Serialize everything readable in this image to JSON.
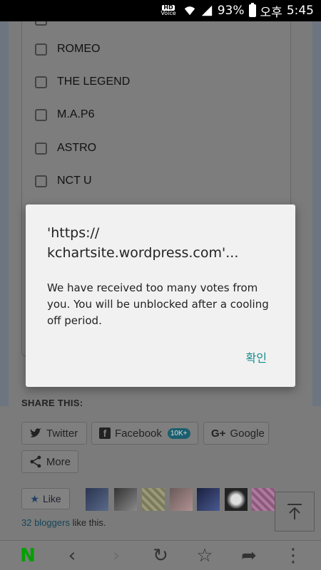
{
  "status_bar": {
    "hd_label": "HD",
    "voice_label": "Voice",
    "battery": "93%",
    "ampm": "오후",
    "time": "5:45"
  },
  "poll": {
    "items": [
      {
        "label": "ROMEO"
      },
      {
        "label": "THE LEGEND"
      },
      {
        "label": "M.A.P6"
      },
      {
        "label": "ASTRO"
      },
      {
        "label": "NCT U"
      }
    ]
  },
  "share": {
    "title": "SHARE THIS:",
    "twitter": "Twitter",
    "facebook": "Facebook",
    "facebook_count": "10K+",
    "google": "Google",
    "google_icon": "G+",
    "more": "More"
  },
  "like": {
    "label": "Like",
    "bloggers_count": "32 bloggers",
    "bloggers_suffix": " like this."
  },
  "dialog": {
    "title": "'https://\nkchartsite.wordpress.com'...",
    "message": "We have received too many votes from you. You will be unblocked after a cooling off period.",
    "ok": "확인"
  },
  "bottom_bar": {
    "icons": [
      "naver-icon",
      "back-icon",
      "forward-icon",
      "reload-icon",
      "bookmark-star-icon",
      "share-icon",
      "menu-icon"
    ]
  },
  "colors": {
    "dialog_bg": "#f1f1f1",
    "ok_color": "#128a8a",
    "naver_green": "#00a000"
  }
}
